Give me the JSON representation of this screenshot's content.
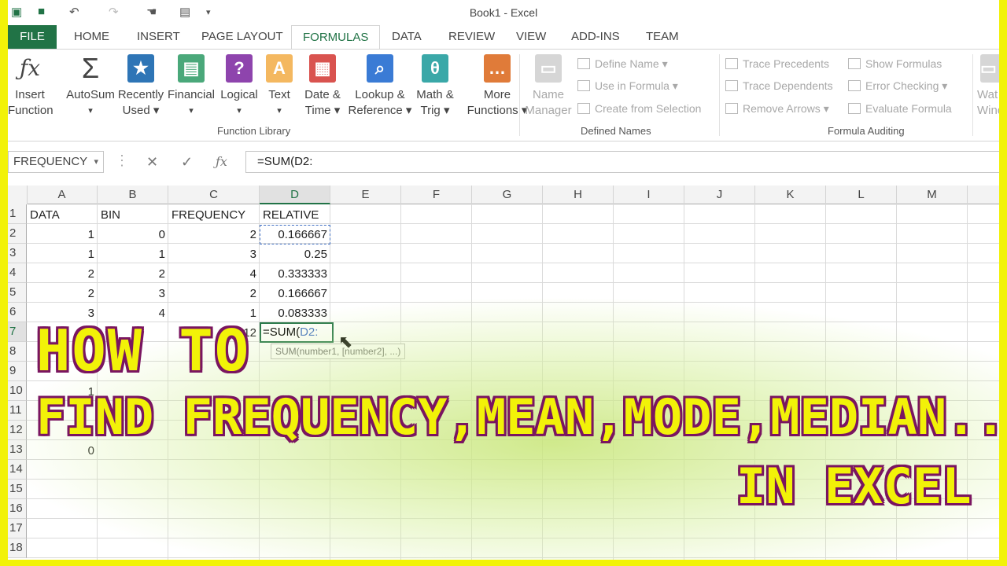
{
  "window": {
    "title": "Book1 - Excel"
  },
  "tabs": [
    "FILE",
    "HOME",
    "INSERT",
    "PAGE LAYOUT",
    "FORMULAS",
    "DATA",
    "REVIEW",
    "VIEW",
    "ADD-INS",
    "TEAM"
  ],
  "active_tab": "FORMULAS",
  "ribbon": {
    "function_library": {
      "label": "Function Library",
      "buttons": [
        {
          "line1": "Insert",
          "line2": "Function"
        },
        {
          "line1": "AutoSum",
          "line2": "▾"
        },
        {
          "line1": "Recently",
          "line2": "Used ▾"
        },
        {
          "line1": "Financial",
          "line2": "▾"
        },
        {
          "line1": "Logical",
          "line2": "▾"
        },
        {
          "line1": "Text",
          "line2": "▾"
        },
        {
          "line1": "Date &",
          "line2": "Time ▾"
        },
        {
          "line1": "Lookup &",
          "line2": "Reference ▾"
        },
        {
          "line1": "Math &",
          "line2": "Trig ▾"
        },
        {
          "line1": "More",
          "line2": "Functions ▾"
        }
      ]
    },
    "defined_names": {
      "label": "Defined Names",
      "name_manager": {
        "line1": "Name",
        "line2": "Manager"
      },
      "items": [
        "Define Name ▾",
        "Use in Formula ▾",
        "Create from Selection"
      ]
    },
    "formula_auditing": {
      "label": "Formula Auditing",
      "left_items": [
        "Trace Precedents",
        "Trace Dependents",
        "Remove Arrows ▾"
      ],
      "right_items": [
        "Show Formulas",
        "Error Checking ▾",
        "Evaluate Formula"
      ],
      "watch": {
        "line1": "Wat",
        "line2": "Wind"
      }
    }
  },
  "formula_bar": {
    "name_box": "FREQUENCY",
    "formula": "=SUM(D2:"
  },
  "columns": [
    "A",
    "B",
    "C",
    "D",
    "E",
    "F",
    "G",
    "H",
    "I",
    "J",
    "K",
    "L",
    "M"
  ],
  "rows": [
    "1",
    "2",
    "3",
    "4",
    "5",
    "6",
    "7",
    "8",
    "9",
    "10",
    "11",
    "12",
    "13",
    "14",
    "15",
    "16",
    "17",
    "18"
  ],
  "cells": {
    "headers": {
      "A": "DATA",
      "B": "BIN",
      "C": "FREQUENCY",
      "D": "RELATIVE"
    },
    "data_rows": [
      {
        "A": "1",
        "B": "0",
        "C": "2",
        "D": "0.166667"
      },
      {
        "A": "1",
        "B": "1",
        "C": "3",
        "D": "0.25"
      },
      {
        "A": "2",
        "B": "2",
        "C": "4",
        "D": "0.333333"
      },
      {
        "A": "2",
        "B": "3",
        "C": "2",
        "D": "0.166667"
      },
      {
        "A": "3",
        "B": "4",
        "C": "1",
        "D": "0.083333"
      }
    ],
    "c7": "12",
    "d7_prefix": "=SUM(",
    "d7_ref": "D2:",
    "a10": "1",
    "a13": "0"
  },
  "tooltip": "SUM(number1, [number2], ...)",
  "overlay": {
    "line1": "HOW TO",
    "line2": "FIND FREQUENCY,MEAN,MODE,MEDIAN...",
    "line3": "IN EXCEL"
  },
  "colors": {
    "accent": "#217346",
    "overlay_text": "#f2f208",
    "overlay_outline": "#7a1560",
    "border": "#f2f208"
  }
}
